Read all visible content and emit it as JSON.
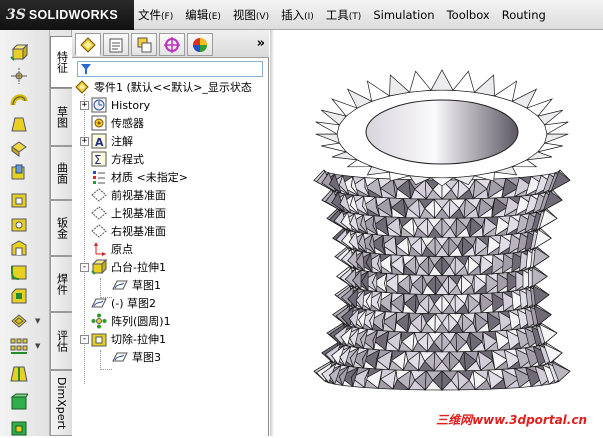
{
  "app": {
    "logo_mark": "3S",
    "logo_text": "SOLIDWORKS"
  },
  "menu": [
    {
      "label": "文件",
      "accel": "(F)"
    },
    {
      "label": "编辑",
      "accel": "(E)"
    },
    {
      "label": "视图",
      "accel": "(V)"
    },
    {
      "label": "插入",
      "accel": "(I)"
    },
    {
      "label": "工具",
      "accel": "(T)"
    },
    {
      "label": "Simulation",
      "accel": ""
    },
    {
      "label": "Toolbox",
      "accel": ""
    },
    {
      "label": "Routing",
      "accel": ""
    }
  ],
  "command_tabs": [
    "特征",
    "草图",
    "曲面",
    "钣金",
    "焊件",
    "评估",
    "DimXpert"
  ],
  "panel": {
    "more_glyph": "»",
    "tree": {
      "root": "零件1 (默认<<默认>_显示状态",
      "history": "History",
      "sensors": "传感器",
      "annotations": "注解",
      "equations": "方程式",
      "material": "材质 <未指定>",
      "front_plane": "前视基准面",
      "top_plane": "上视基准面",
      "right_plane": "右视基准面",
      "origin": "原点",
      "boss_extrude": "凸台-拉伸1",
      "sketch1": "草图1",
      "sketch2": "(-) 草图2",
      "circular_pattern": "阵列(圆周)1",
      "cut_extrude": "切除-拉伸1",
      "sketch3": "草图3"
    }
  },
  "watermark": "三维网www.3dportal.cn",
  "colors": {
    "logo_bg": "#1a1a1a",
    "selection_blue": "#8ab0d8",
    "model_light": "#f4f4f6",
    "model_mid": "#b9b4be",
    "model_dark": "#6f6a76",
    "watermark": "#e02020"
  }
}
